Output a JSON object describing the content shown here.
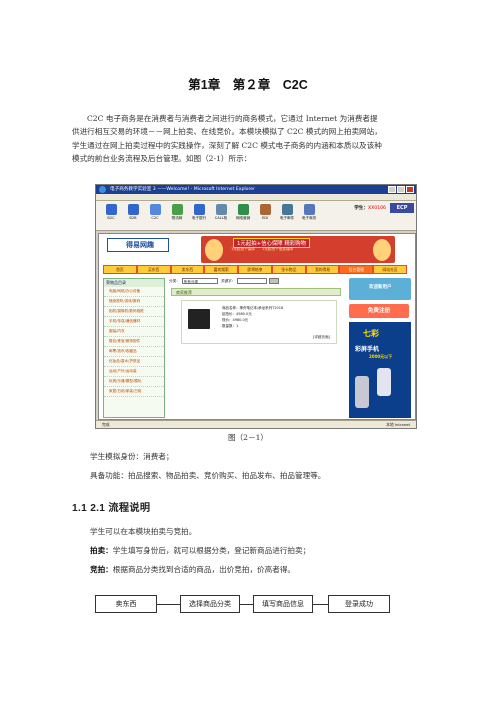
{
  "heading": "第1章　第２章　C2C",
  "intro": {
    "lines": [
      "C2C 电子商务是在消费者与消费者之间进行的商务模式，它通过 Internet 为消费者提",
      "供进行相互交易的环境－－网上拍卖、在线竞价。本模块模拟了 C2C 模式的网上拍卖网站，",
      "学生通过在网上拍卖过程中的实践操作，深刻了解 C2C 模式电子商务的内涵和本质以及该种",
      "模式的前台业务流程及后台管理。如图（2-1）所示："
    ]
  },
  "screenshot": {
    "window_title": "电子商务教学实验室 3 ——Welcome! - Microsoft Internet Explorer",
    "toolbar_items": [
      "B2C",
      "B2B",
      "C2C",
      "物流网",
      "电子银行",
      "CALL柜",
      "网络营销",
      "EDI",
      "电子邮件",
      "电子商务"
    ],
    "toolbar_colors": [
      "#3366cc",
      "#3366cc",
      "#5588dd",
      "#4aa04a",
      "#3366cc",
      "#6688aa",
      "#2f8f4a",
      "#aa6633",
      "#447799",
      "#5577bb"
    ],
    "student_label": "学生：",
    "student_id": "XX0106",
    "ecp_logo": "ECP",
    "site_logo": "得易网趣",
    "banner_text": "1元起拍+信心保障 精彩购物",
    "banner_sub": "1元起拍＋保障　　1元起拍＋信息保障",
    "nav": [
      "首页",
      "买东西",
      "卖东西",
      "嘉宾搜索",
      "即将结束",
      "张卡物品",
      "我的得易",
      "后台管理",
      "网站社区"
    ],
    "sidebar_title": "荣物品目录",
    "sidebar_items": [
      "电脑/网络/办公设备",
      "随身视听/游戏/数码",
      "相机/摄像机/数码相框",
      "手机/传真/通信器材",
      "服装/内衣",
      "鞋包/珠宝/服饰配件",
      "邮票/钱币/收藏品",
      "化妆品/香水/护肤品",
      "运动/户外/运动装",
      "玩具/乐器/模型/模玩",
      "家居/日用/家装/日用"
    ],
    "filter": {
      "category_label": "分类：",
      "category_value": "所有分类",
      "keyword_label": "关键字："
    },
    "product_header": "商家推荐",
    "product": {
      "name": "商品名称：神舟笔记本/承龙系列T2018",
      "price": "起拍价：4980.0元",
      "current": "现价：4980.0元",
      "qty": "数量数：1"
    },
    "detail_link": "[详细页面]",
    "promo1": "欢迎新用户",
    "promo2": "免费注册",
    "promo3_title": "七彩",
    "promo3_sub": "彩屏手机",
    "promo3_price": "2000元以下",
    "status_left": "完成",
    "status_right": "本地 Intranet"
  },
  "figure_caption": "图（2－1）",
  "role": "学生模拟身份：消费者；",
  "functions": "具备功能：拍品搜索、物品拍卖、竞价购买、拍品发布、拍品管理等。",
  "section_title": "1.1 2.1 流程说明",
  "flow_intro": "学生可以在本模块拍卖与竞拍。",
  "auction_label": "拍卖：",
  "auction_text": "学生填写身份后，就可以根据分类，登记新商品进行拍卖；",
  "bidding_label": "竞拍：",
  "bidding_text": "根据商品分类找到合适的商品，出价竞拍，价高者得。",
  "flow_steps": [
    "卖东西",
    "选择商品分类",
    "填写商品信息",
    "登录成功"
  ]
}
